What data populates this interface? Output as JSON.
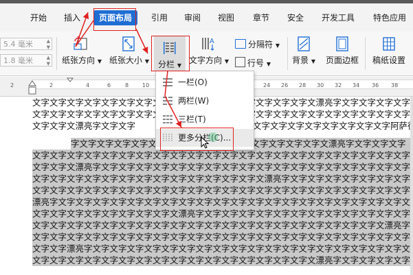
{
  "tabs": [
    "开始",
    "插入",
    "页面布局",
    "引用",
    "审阅",
    "视图",
    "章节",
    "安全",
    "开发工具",
    "特色应用"
  ],
  "ribbon": {
    "inputs": [
      "5.4 毫米",
      "1.8 毫米"
    ],
    "orientation": "纸张方向",
    "size": "纸张大小",
    "columns": "分栏",
    "text_direction": "文字方向",
    "separator": "分隔符",
    "line_numbers": "行号",
    "background": "背景",
    "page_border": "页面边框",
    "draft_settings": "稿纸设置"
  },
  "ruler": [
    "2",
    "2",
    "4",
    "6",
    "8",
    "10",
    "12",
    "24",
    "26",
    "28",
    "30",
    "32",
    "34",
    "36",
    "38"
  ],
  "dropdown": {
    "one": "一栏(O)",
    "two": "两栏(W)",
    "three": "三栏(T)",
    "more": "更多分栏(C)..."
  },
  "doc": {
    "l1": "文字文字文字文字文字文字文字文字文字文字文字文字文字文字文字文字文漂亮字文字文字文字文字文字",
    "l2": "文字文字文字文字文字文字文字文字文字文字文字文字文字文字文字文字文字文字文字文字文字文字文字",
    "l3a": "文字文字文漂亮字文字文字",
    "l3b": "文字文字文字文字文字文字文字文字阿萨德.",
    "l4": "字文字文字文字文字文字文字文字文字文字文字文字文字文字文字文漂亮字文字文字文字",
    "l5": "文字文字文字文字文字文字文字文字文字文字文字文字文字文字文字文字文字文字文字文字文字文字文字",
    "l6": "文字文字文漂亮字文字文字文字文字文字文字文字文字文字文字文字文字文字文字文字文字文字文字文字",
    "l7": "文字文字文字文字文字文字文字文字文字文字文字文字文字文漂亮字文字文字文字文字文字文字文字文字",
    "l8": "文字文字文字文字文字文字文字文字文字文字文字文字文字文字文字文字文字文字文字文字文字文字文字",
    "l9": "漂亮字文字文字文字文字文字文字文字文字文字文字文字文字文字文字文字文字文字文字文字文字文字",
    "l10": "文字文字文字文字文字文字文字文字文漂亮字文字文字文字文字文字文字文字文字文字文字文字文字文字",
    "l11": "文字文字文字文字文字文字文字文字文字文字文字文字文字文字文字文字文字文字文字文字文漂亮字文字",
    "l12": "文字文字文字文字文字文字文字文字文字文字文字文字文字文字文字文字文字文字文字文字文字文字文字",
    "l13": "文字文字漂亮字文字文字文字文字文字文字文字文字文字文字文字文字文字文字文字文字文字文字文字"
  }
}
